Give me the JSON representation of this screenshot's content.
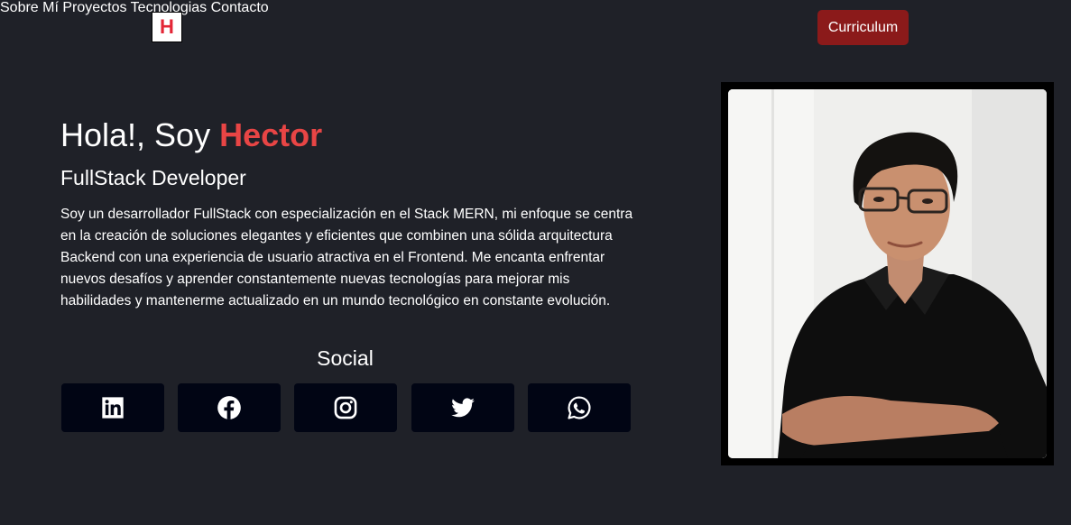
{
  "logo": {
    "letter": "H"
  },
  "nav": {
    "items": [
      {
        "label": "Sobre Mí"
      },
      {
        "label": "Proyectos"
      },
      {
        "label": "Tecnologias"
      },
      {
        "label": "Contacto"
      }
    ],
    "cv_label": "Curriculum"
  },
  "hero": {
    "greeting": "Hola!, Soy ",
    "name": "Hector",
    "role": "FullStack Developer",
    "bio": "Soy un desarrollador FullStack con especialización en el Stack MERN, mi enfoque se centra en la creación de soluciones elegantes y eficientes que combinen una sólida arquitectura Backend con una experiencia de usuario atractiva en el Frontend. Me encanta enfrentar nuevos desafíos y aprender constantemente nuevas tecnologías para mejorar mis habilidades y mantenerme actualizado en un mundo tecnológico en constante evolución."
  },
  "social": {
    "title": "Social",
    "icons": [
      "linkedin-icon",
      "facebook-icon",
      "instagram-icon",
      "twitter-icon",
      "whatsapp-icon"
    ]
  },
  "colors": {
    "background": "#1f2128",
    "accent": "#e84545",
    "cv_button": "#8b1a1a",
    "social_button": "#010514"
  }
}
